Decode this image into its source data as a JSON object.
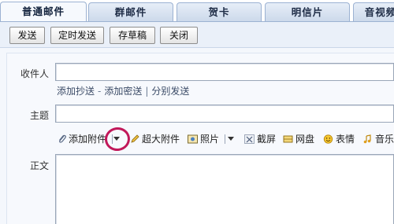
{
  "tabs": [
    {
      "label": "普通邮件",
      "active": true
    },
    {
      "label": "群邮件",
      "active": false
    },
    {
      "label": "贺卡",
      "active": false
    },
    {
      "label": "明信片",
      "active": false
    },
    {
      "label": "音视频",
      "active": false
    }
  ],
  "toolbar": {
    "send_label": "发送",
    "timed_send_label": "定时发送",
    "save_draft_label": "存草稿",
    "close_label": "关闭"
  },
  "form": {
    "recipient_label": "收件人",
    "recipient_value": "",
    "add_cc_label": "添加抄送",
    "add_bcc_label": "添加密送",
    "separate_send_label": "分别发送",
    "subject_label": "主题",
    "subject_value": "",
    "body_label": "正文",
    "body_value": ""
  },
  "attach_toolbar": {
    "add_attachment_label": "添加附件",
    "large_attachment_label": "超大附件",
    "photo_label": "照片",
    "screenshot_label": "截屏",
    "netdisk_label": "网盘",
    "emoji_label": "表情",
    "music_label": "音乐"
  },
  "icons": {
    "attachment": "paperclip-icon",
    "large_attachment": "pencil-icon",
    "photo": "photo-icon",
    "screenshot": "scissors-icon",
    "netdisk": "disk-icon",
    "emoji": "smiley-icon",
    "music": "music-note-icon"
  },
  "annotation": {
    "color": "#c1185a"
  }
}
